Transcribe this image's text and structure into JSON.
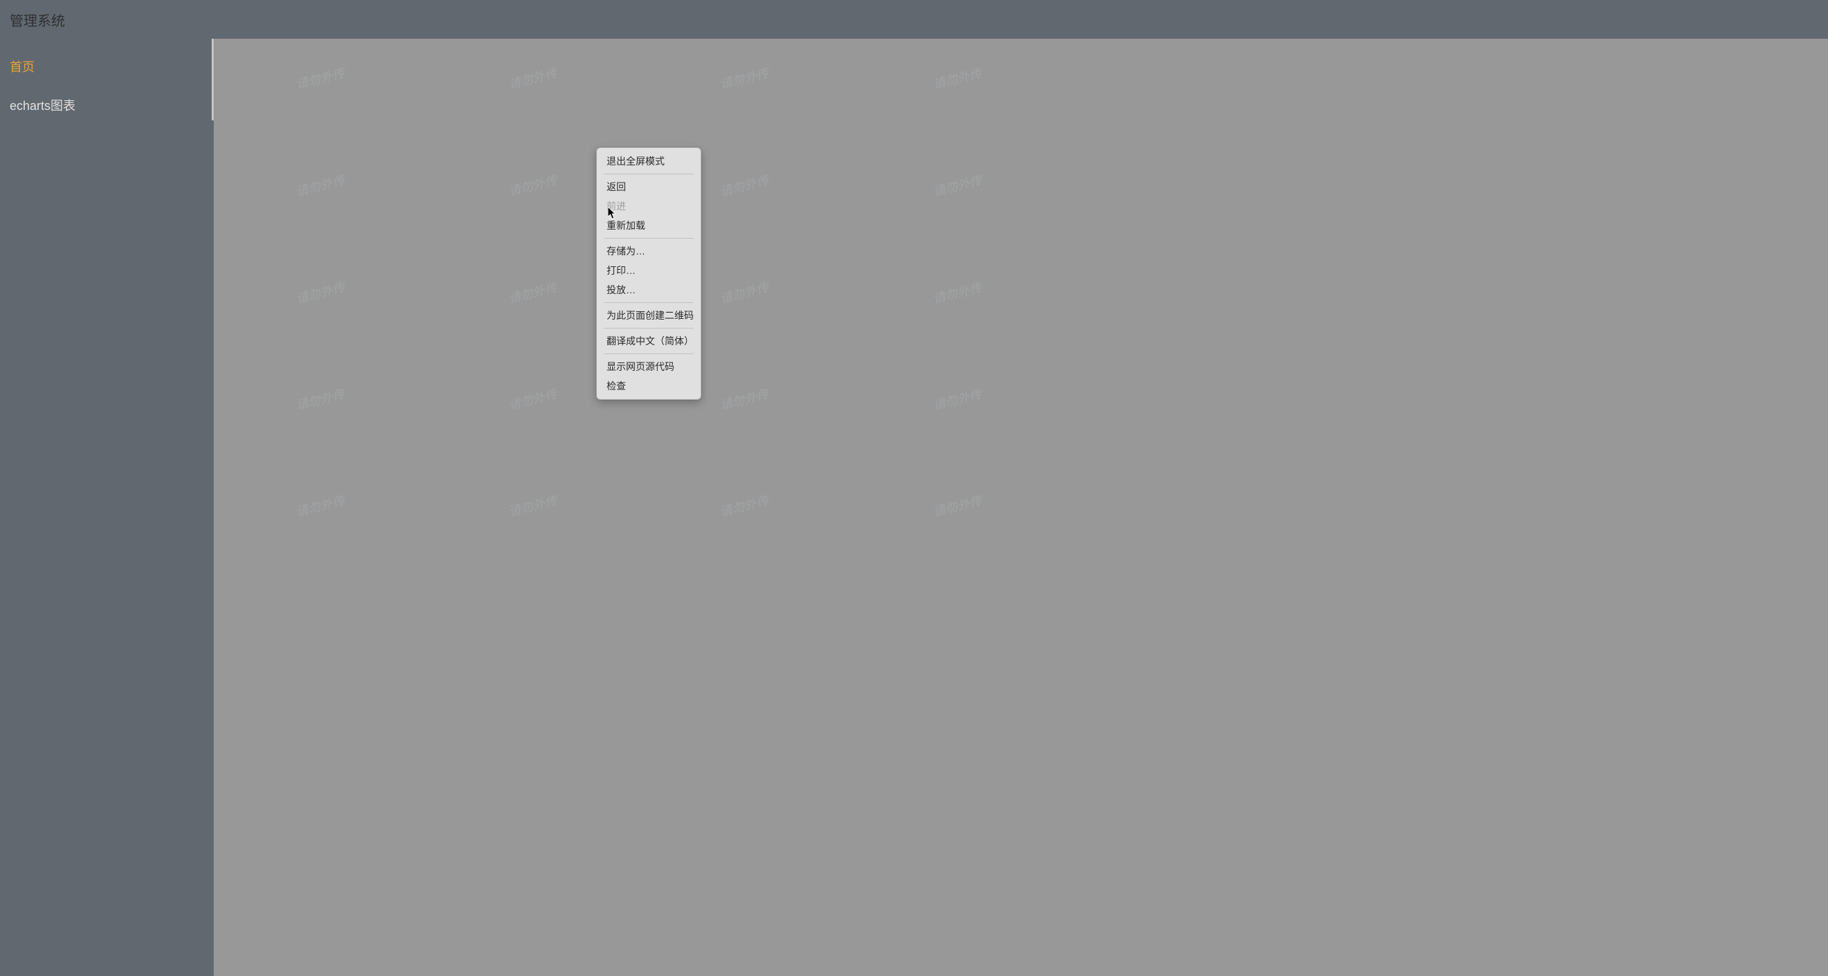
{
  "header": {
    "title": "管理系统"
  },
  "sidebar": {
    "items": [
      {
        "label": "首页",
        "active": true
      },
      {
        "label": "echarts图表",
        "active": false
      }
    ]
  },
  "watermark": {
    "text": "请勿外传"
  },
  "context_menu": {
    "items": [
      {
        "label": "退出全屏模式",
        "disabled": false,
        "divider_after": true
      },
      {
        "label": "返回",
        "disabled": false,
        "divider_after": false
      },
      {
        "label": "前进",
        "disabled": true,
        "divider_after": false
      },
      {
        "label": "重新加载",
        "disabled": false,
        "divider_after": true
      },
      {
        "label": "存储为…",
        "disabled": false,
        "divider_after": false
      },
      {
        "label": "打印…",
        "disabled": false,
        "divider_after": false
      },
      {
        "label": "投放…",
        "disabled": false,
        "divider_after": true
      },
      {
        "label": "为此页面创建二维码",
        "disabled": false,
        "divider_after": true
      },
      {
        "label": "翻译成中文（简体）",
        "disabled": false,
        "divider_after": true
      },
      {
        "label": "显示网页源代码",
        "disabled": false,
        "divider_after": false
      },
      {
        "label": "检查",
        "disabled": false,
        "divider_after": false
      }
    ]
  }
}
